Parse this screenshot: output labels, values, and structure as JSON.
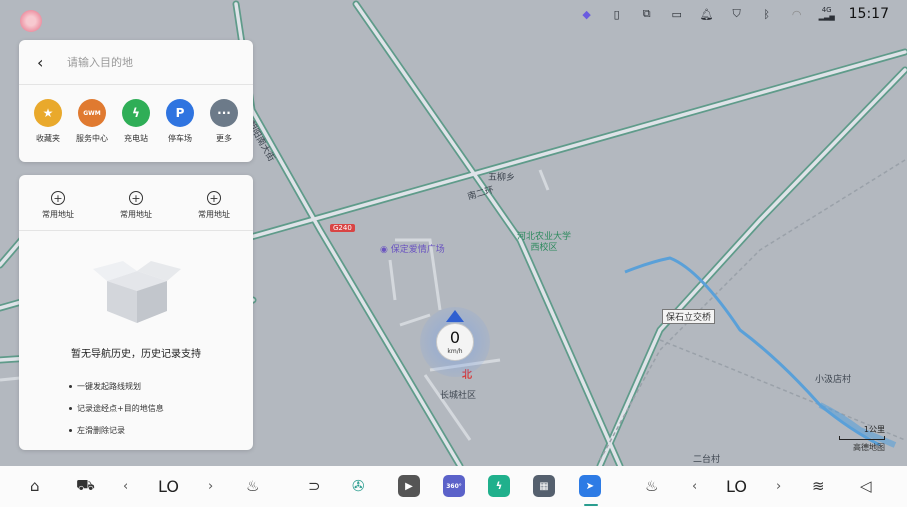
{
  "status_bar": {
    "time": "15:17",
    "icons": [
      "assistant-icon",
      "vibrate-icon",
      "screen-mirror-icon",
      "dashcam-icon",
      "bell-icon",
      "shield-icon",
      "bluetooth-icon",
      "wifi-icon",
      "signal-4g-icon"
    ],
    "signal_label": "4G"
  },
  "search": {
    "placeholder": "请输入目的地",
    "categories": [
      {
        "label": "收藏夹",
        "icon": "star-icon",
        "glyph": "★",
        "color": "#e9a92c"
      },
      {
        "label": "服务中心",
        "icon": "gwm-logo-icon",
        "glyph": "GWM",
        "color": "#e07a30"
      },
      {
        "label": "充电站",
        "icon": "lightning-icon",
        "glyph": "⚡",
        "color": "#2fae57"
      },
      {
        "label": "停车场",
        "icon": "parking-icon",
        "glyph": "P",
        "color": "#2f74e0"
      },
      {
        "label": "更多",
        "icon": "more-icon",
        "glyph": "···",
        "color": "#6c7a89"
      }
    ]
  },
  "history": {
    "addresses": [
      "常用地址",
      "常用地址",
      "常用地址"
    ],
    "empty_title": "暂无导航历史，历史记录支持",
    "bullets": [
      "一键发起路线规划",
      "记录途经点+目的地信息",
      "左滑删除记录"
    ]
  },
  "map": {
    "labels": {
      "road_chaoyang": "朝阳南大街",
      "road_ring2": "南二环",
      "village_wuzhi": "五柳乡",
      "shield_g240": "G240",
      "poi_plaza": "保定爱情广场",
      "poi_university": "河北农业大学西校区",
      "bridge": "保石立交桥",
      "community": "长城社区",
      "village_xiaoji": "小汲店村",
      "village_ertai": "二台村",
      "north": "北"
    },
    "speed": {
      "value": "0",
      "unit": "km/h"
    },
    "scale": {
      "value": "1公里",
      "provider": "高德地图"
    }
  },
  "dock": {
    "temp_left": "LO",
    "temp_right": "LO",
    "badge_360": "360°"
  }
}
